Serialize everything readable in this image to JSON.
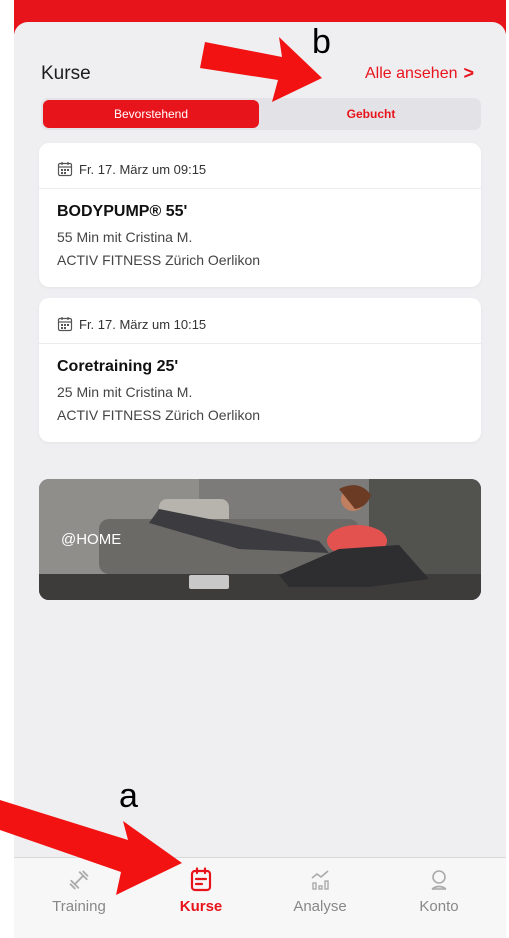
{
  "header": {
    "section_title": "Kurse",
    "see_all_label": "Alle ansehen",
    "see_all_chevron": ">"
  },
  "segments": [
    {
      "label": "Bevorstehend",
      "active": true
    },
    {
      "label": "Gebucht",
      "active": false
    }
  ],
  "courses": [
    {
      "date": "Fr. 17. März um 09:15",
      "title": "BODYPUMP® 55'",
      "duration_trainer": "55 Min mit Cristina M.",
      "location": "ACTIV FITNESS Zürich Oerlikon"
    },
    {
      "date": "Fr. 17. März um 10:15",
      "title": "Coretraining 25'",
      "duration_trainer": "25 Min mit Cristina M.",
      "location": "ACTIV FITNESS Zürich Oerlikon"
    }
  ],
  "banner": {
    "label": "@HOME"
  },
  "tabs": [
    {
      "label": "Training",
      "icon": "dumbbell-icon",
      "active": false
    },
    {
      "label": "Kurse",
      "icon": "calendar-icon",
      "active": true
    },
    {
      "label": "Analyse",
      "icon": "chart-icon",
      "active": false
    },
    {
      "label": "Konto",
      "icon": "user-icon",
      "active": false
    }
  ],
  "annotations": {
    "a": "a",
    "b": "b"
  },
  "colors": {
    "accent": "#e8141c",
    "background": "#efeff2"
  }
}
